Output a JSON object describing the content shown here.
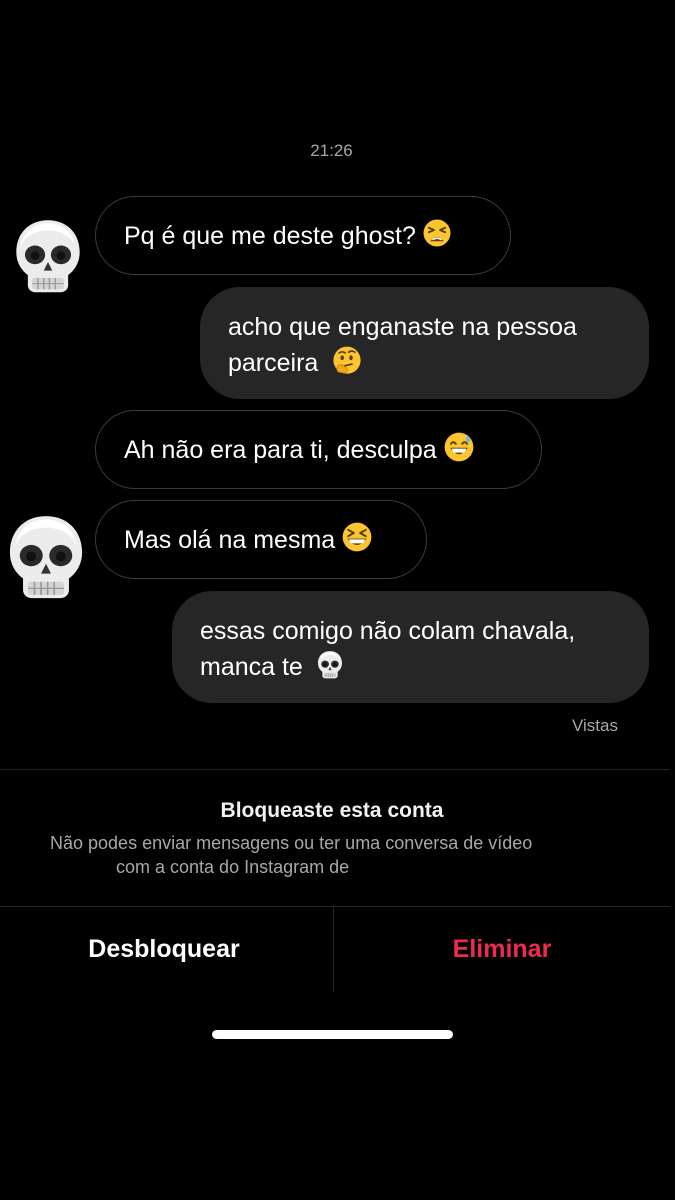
{
  "conversation": {
    "timestamp": "21:26",
    "messages": [
      {
        "direction": "incoming",
        "text": "Pq é que me deste ghost?",
        "emoji": "tired-face-emoji"
      },
      {
        "direction": "outgoing",
        "lines": [
          "acho que enganaste na pessoa",
          "parceira"
        ],
        "emoji": "thinking-face-emoji"
      },
      {
        "direction": "incoming",
        "text": "Ah não era para ti, desculpa",
        "emoji": "grinning-sweat-emoji"
      },
      {
        "direction": "incoming",
        "text": "Mas olá na mesma",
        "emoji": "laughing-squint-emoji"
      },
      {
        "direction": "outgoing",
        "lines": [
          "essas comigo não colam chavala,",
          "manca te"
        ],
        "emoji": "skull-emoji"
      }
    ],
    "avatar_icon": "skull-emoji",
    "seen_label": "Vistas"
  },
  "blocked_notice": {
    "title": "Bloqueaste esta conta",
    "description_line1": "Não podes enviar mensagens ou ter uma conversa de vídeo",
    "description_line2": "com a conta do Instagram de"
  },
  "actions": {
    "unblock_label": "Desbloquear",
    "delete_label": "Eliminar"
  },
  "colors": {
    "background": "#000000",
    "outgoing_bubble": "#262626",
    "incoming_border": "#3a3a3a",
    "secondary_text": "#a8a8a8",
    "destructive": "#ed2b4f"
  }
}
